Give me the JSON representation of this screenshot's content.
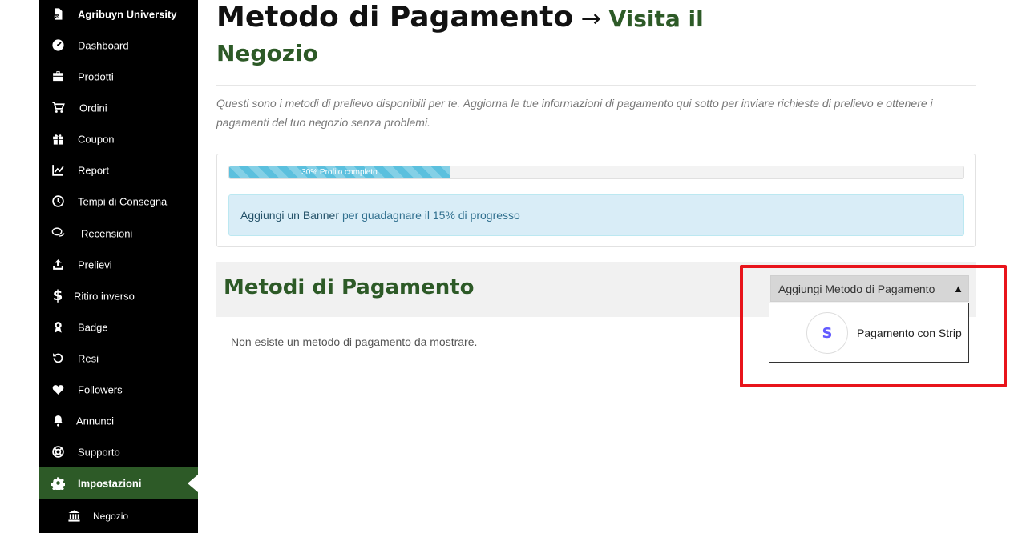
{
  "sidebar": {
    "items": [
      {
        "label": "Agribuyn University",
        "icon": "pdf-file-icon"
      },
      {
        "label": "Dashboard",
        "icon": "gauge-icon"
      },
      {
        "label": "Prodotti",
        "icon": "briefcase-icon"
      },
      {
        "label": "Ordini",
        "icon": "cart-icon"
      },
      {
        "label": "Coupon",
        "icon": "gift-icon"
      },
      {
        "label": "Report",
        "icon": "line-chart-icon"
      },
      {
        "label": "Tempi di Consegna",
        "icon": "clock-icon"
      },
      {
        "label": "Recensioni",
        "icon": "comments-icon"
      },
      {
        "label": "Prelievi",
        "icon": "upload-icon"
      },
      {
        "label": "Ritiro inverso",
        "icon": "dollar-icon"
      },
      {
        "label": "Badge",
        "icon": "award-icon"
      },
      {
        "label": "Resi",
        "icon": "undo-icon"
      },
      {
        "label": "Followers",
        "icon": "heart-icon"
      },
      {
        "label": "Annunci",
        "icon": "bell-icon"
      },
      {
        "label": "Supporto",
        "icon": "lifebuoy-icon"
      },
      {
        "label": "Impostazioni",
        "icon": "gear-icon"
      },
      {
        "label": "Negozio",
        "icon": "bank-icon"
      }
    ],
    "active_index": 15
  },
  "header": {
    "title": "Metodo di Pagamento",
    "arrow": "→",
    "store_link_part1": "Visita il",
    "store_link_part2": "Negozio"
  },
  "description": "Questi sono i metodi di prelievo disponibili per te. Aggiorna le tue informazioni di pagamento qui sotto per inviare richieste di prelievo e ottenere i pagamenti del tuo negozio senza problemi.",
  "profile": {
    "progress_percent": 30,
    "progress_label": "30% Profilo completo",
    "tip_link": "Aggiungi un Banner",
    "tip_text": "per guadagnare il 15% di progresso"
  },
  "methods": {
    "title": "Metodi di Pagamento",
    "add_button_label": "Aggiungi Metodo di Pagamento",
    "caret": "▲",
    "dropdown_option_label": "Pagamento con Strip",
    "dropdown_option_logo": "S",
    "empty_message": "Non esiste un metodo di pagamento da mostrare."
  },
  "colors": {
    "sidebar_bg": "#000000",
    "accent_green": "#2d5a27",
    "progress_blue": "#5bc0de",
    "info_bg": "#d9edf7",
    "highlight_red": "#e8141b",
    "stripe_purple": "#635bff"
  }
}
